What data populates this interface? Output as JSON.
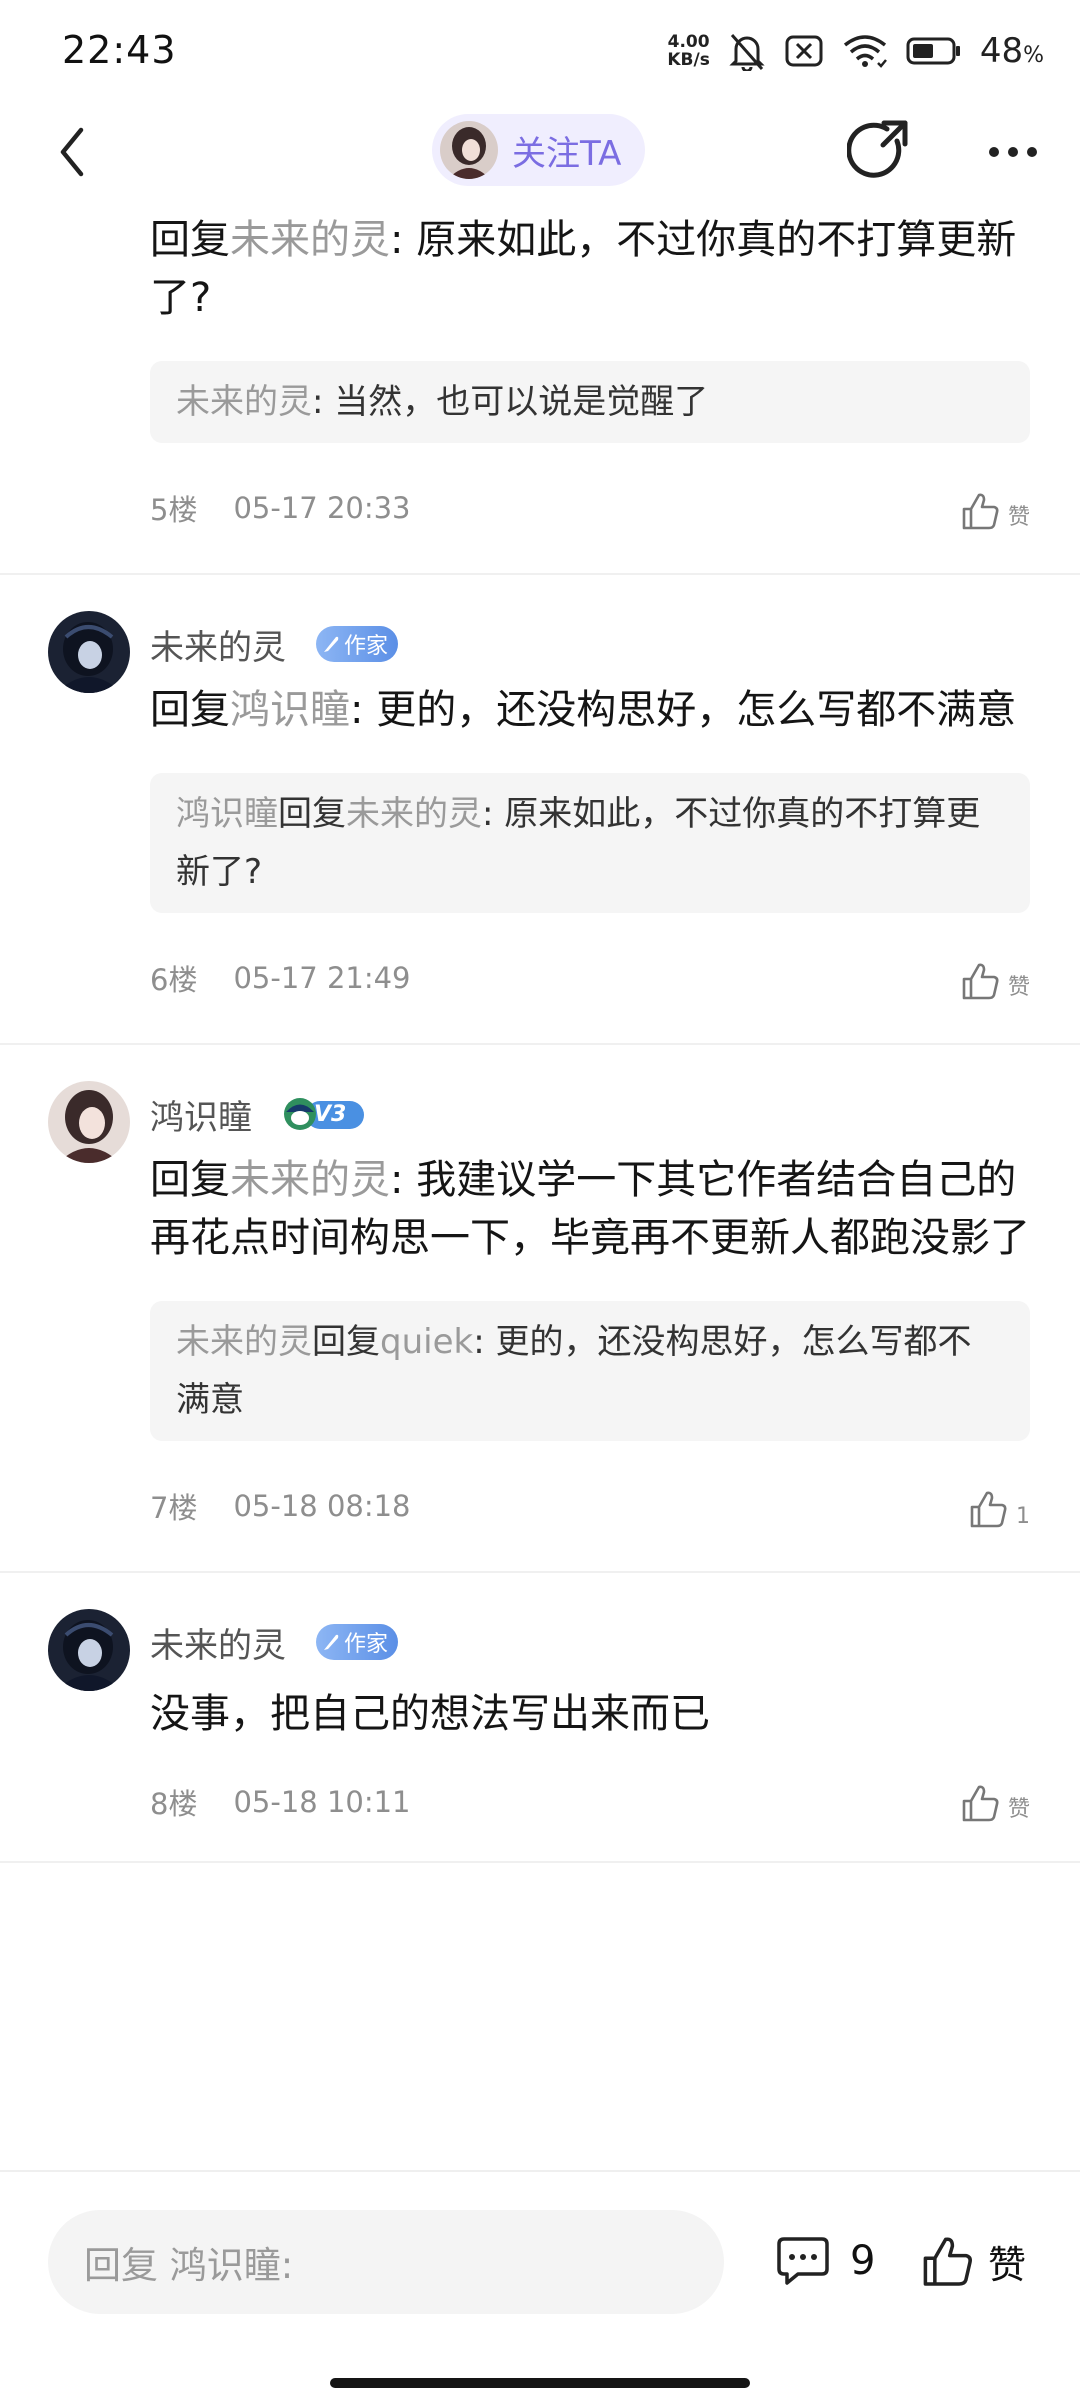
{
  "status_bar": {
    "time": "22:43",
    "net_speed_value": "4.00",
    "net_speed_unit": "KB/s",
    "battery": "48",
    "battery_unit": "%"
  },
  "nav": {
    "follow_label": "关注TA"
  },
  "comments": [
    {
      "partial": true,
      "pre": "回复",
      "target": "未来的灵",
      "sep": ": ",
      "text": "原来如此，不过你真的不打算更新了?",
      "quote": {
        "author": "未来的灵",
        "reply_word": "",
        "reply_target": "",
        "sep": ": ",
        "text": "当然，也可以说是觉醒了"
      },
      "floor": "5楼",
      "time": "05-17 20:33",
      "like": "赞"
    },
    {
      "author": "未来的灵",
      "badge": "作家",
      "pre": "回复",
      "target": "鸿识瞳",
      "sep": ": ",
      "text": "更的，还没构思好，怎么写都不满意",
      "quote": {
        "author": "鸿识瞳",
        "reply_word": "回复",
        "reply_target": "未来的灵",
        "sep": ": ",
        "text": "原来如此，不过你真的不打算更新了?"
      },
      "floor": "6楼",
      "time": "05-17 21:49",
      "like": "赞"
    },
    {
      "author": "鸿识瞳",
      "badge": "V3",
      "pre": "回复",
      "target": "未来的灵",
      "sep": ": ",
      "text": "我建议学一下其它作者结合自己的再花点时间构思一下，毕竟再不更新人都跑没影了",
      "quote": {
        "author": "未来的灵",
        "reply_word": "回复",
        "reply_target": "quiek",
        "sep": ": ",
        "text": "更的，还没构思好，怎么写都不满意"
      },
      "floor": "7楼",
      "time": "05-18 08:18",
      "like": "1"
    },
    {
      "author": "未来的灵",
      "badge": "作家",
      "text": "没事，把自己的想法写出来而已",
      "floor": "8楼",
      "time": "05-18 10:11",
      "like": "赞"
    }
  ],
  "bottom_bar": {
    "reply_placeholder": "回复 鸿识瞳:",
    "comment_count": "9",
    "like_label": "赞"
  },
  "colors": {
    "accent": "#7b6de2",
    "follow_bg": "#f0eefe",
    "muted": "#9a9a9a",
    "quote_bg": "#f5f5f5"
  }
}
